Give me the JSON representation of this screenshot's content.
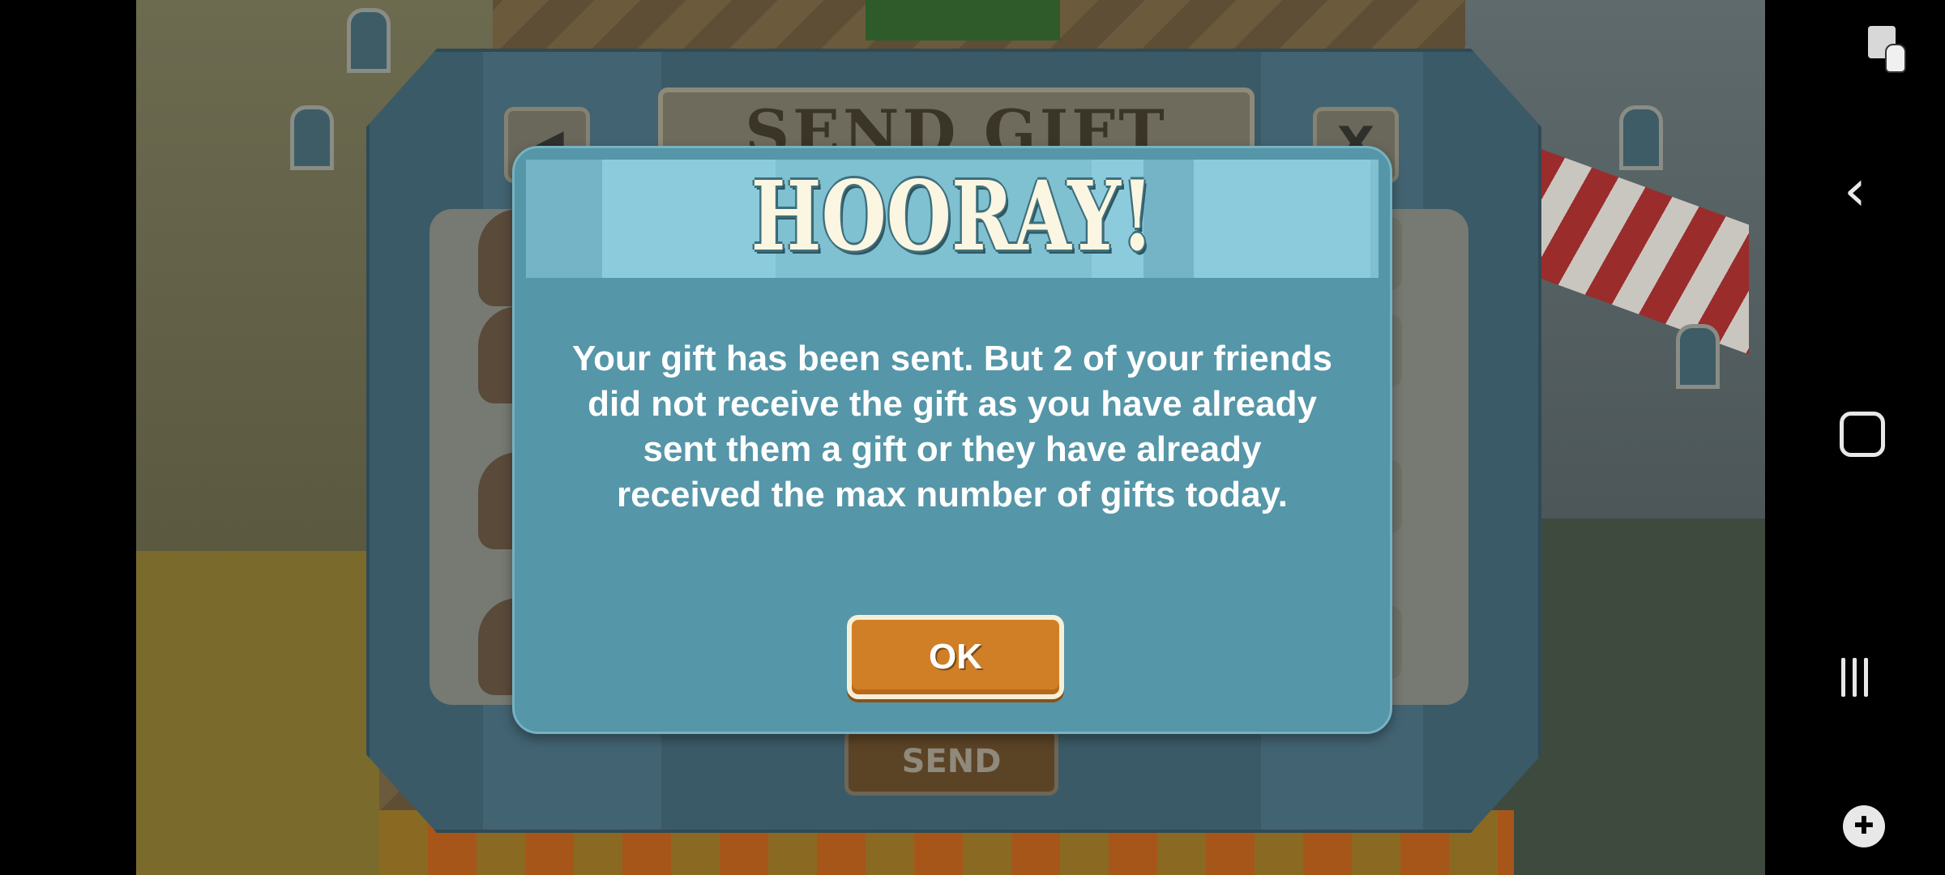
{
  "game": {
    "send_gift_panel": {
      "title": "SEND GIFT",
      "back_label": "◀",
      "close_label": "X",
      "send_label": "SEND",
      "friends": [
        {
          "checked": true
        },
        {
          "checked": true
        },
        {
          "checked": true
        },
        {
          "checked": true
        }
      ]
    },
    "dialog": {
      "title": "HOORAY!",
      "message": "Your gift has been sent. But 2 of your friends did not receive the gift as you have already sent them a gift or they have already received the max number of gifts today.",
      "ok_label": "OK"
    }
  },
  "nav_bar": {
    "icons": [
      "screenshot-icon",
      "back-icon",
      "home-icon",
      "recents-icon",
      "game-tools-icon"
    ],
    "back_glyph": "‹"
  },
  "colors": {
    "dialog_bg": "#5596a8",
    "header_bg": "#7fc0d1",
    "ok_button": "#d07f27",
    "title_text": "#fbf6e1"
  }
}
